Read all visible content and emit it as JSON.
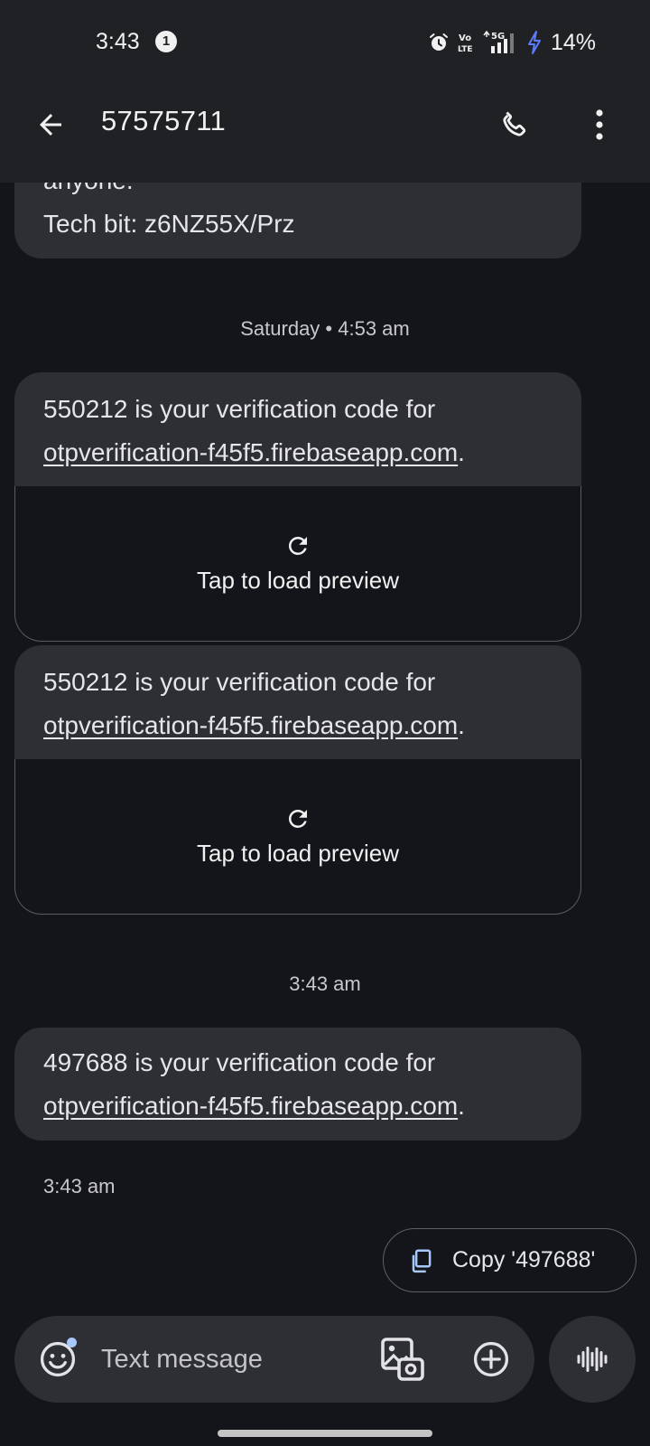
{
  "status_bar": {
    "time": "3:43",
    "notification_count": "1",
    "battery": "14%",
    "network": "5G"
  },
  "app_bar": {
    "title": "57575711"
  },
  "messages": [
    {
      "partial_line": "anyone.",
      "tech_bit": "Tech bit: z6NZ55X/Prz"
    },
    {
      "code_text": "550212 is your verification code for",
      "link": "otpverification-f45f5.firebaseapp.com",
      "punct": "."
    },
    {
      "code_text": "550212 is your verification code for",
      "link": "otpverification-f45f5.firebaseapp.com",
      "punct": "."
    },
    {
      "code_text": "497688 is your verification code for",
      "link": "otpverification-f45f5.firebaseapp.com",
      "punct": "."
    }
  ],
  "previews": [
    {
      "label": "Tap to load preview"
    },
    {
      "label": "Tap to load preview"
    }
  ],
  "timestamps": {
    "saturday": "Saturday • 4:53 am",
    "today": "3:43 am",
    "last_msg_time": "3:43 am"
  },
  "copy_chip": {
    "label": "Copy '497688'"
  },
  "compose": {
    "placeholder": "Text message"
  },
  "colors": {
    "background": "#13151a",
    "bubble": "#2d2f35",
    "bar": "#1f2125",
    "accent": "#a8c7fa"
  }
}
